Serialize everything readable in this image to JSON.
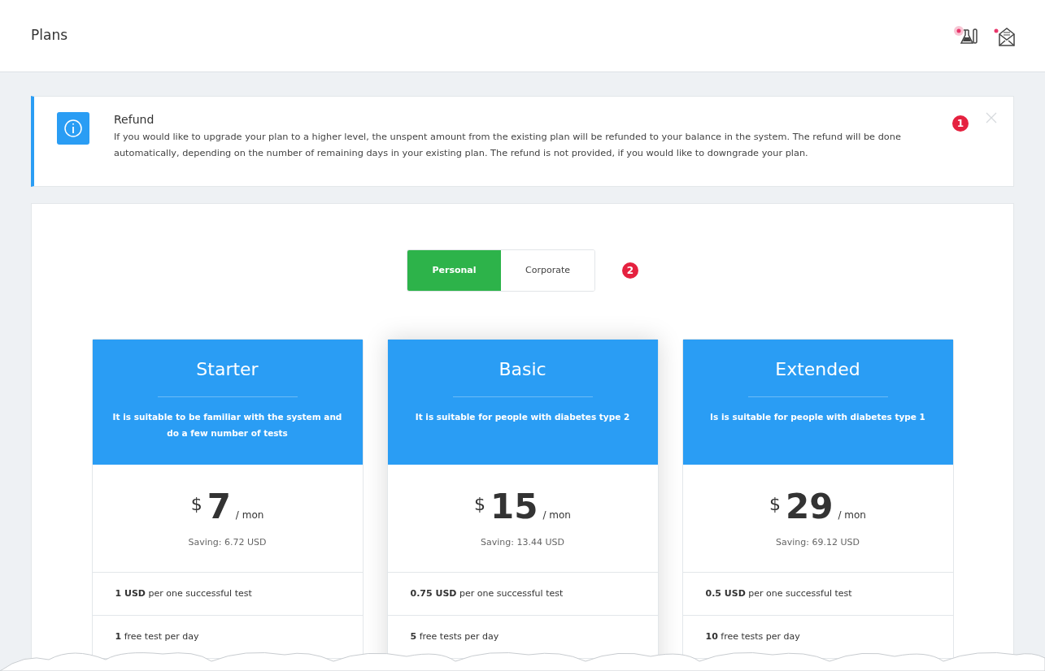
{
  "header": {
    "title": "Plans"
  },
  "alert": {
    "title": "Refund",
    "text": "If you would like to upgrade your plan to a higher level, the unspent amount from the existing plan will be refunded to your balance in the system. The refund will be done automatically, depending on the number of remaining days in your existing plan. The refund is not provided, if you would like to downgrade your plan.",
    "marker": "1"
  },
  "toggle": {
    "options": [
      {
        "label": "Personal",
        "selected": true
      },
      {
        "label": "Corporate",
        "selected": false
      }
    ],
    "marker": "2"
  },
  "plans": [
    {
      "name": "Starter",
      "description": "It is suitable to be familiar with the system and do a few number of tests",
      "currency": "$",
      "price": "7",
      "period": "/ mon",
      "saving": "Saving: 6.72 USD",
      "highlighted": false,
      "features": [
        "**1 USD** per one successful test",
        "**1** free test per day"
      ]
    },
    {
      "name": "Basic",
      "description": "It is suitable for people with diabetes type 2",
      "currency": "$",
      "price": "15",
      "period": "/ mon",
      "saving": "Saving: 13.44 USD",
      "highlighted": true,
      "features": [
        "**0.75 USD** per one successful test",
        "**5** free tests per day"
      ]
    },
    {
      "name": "Extended",
      "description": "Is is suitable for people with diabetes type 1",
      "currency": "$",
      "price": "29",
      "period": "/ mon",
      "saving": "Saving: 69.12 USD",
      "highlighted": false,
      "features": [
        "**0.5 USD** per one successful test",
        "**10** free tests per day"
      ]
    }
  ]
}
